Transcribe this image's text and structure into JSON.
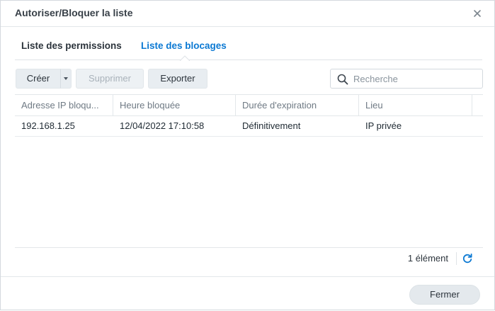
{
  "window": {
    "title": "Autoriser/Bloquer la liste"
  },
  "tabs": [
    {
      "label": "Liste des permissions",
      "active": false
    },
    {
      "label": "Liste des blocages",
      "active": true
    }
  ],
  "toolbar": {
    "create_label": "Créer",
    "delete_label": "Supprimer",
    "export_label": "Exporter",
    "search_placeholder": "Recherche"
  },
  "table": {
    "columns": [
      "Adresse IP bloqu...",
      "Heure bloquée",
      "Durée d'expiration",
      "Lieu"
    ],
    "rows": [
      {
        "ip": "192.168.1.25",
        "time": "12/04/2022 17:10:58",
        "expiration": "Définitivement",
        "location": "IP privée"
      }
    ]
  },
  "footer": {
    "count": "1 élément"
  },
  "actions": {
    "close_label": "Fermer"
  },
  "colors": {
    "accent": "#0b79d3",
    "text": "#1f2a33",
    "muted": "#6f7a84"
  }
}
